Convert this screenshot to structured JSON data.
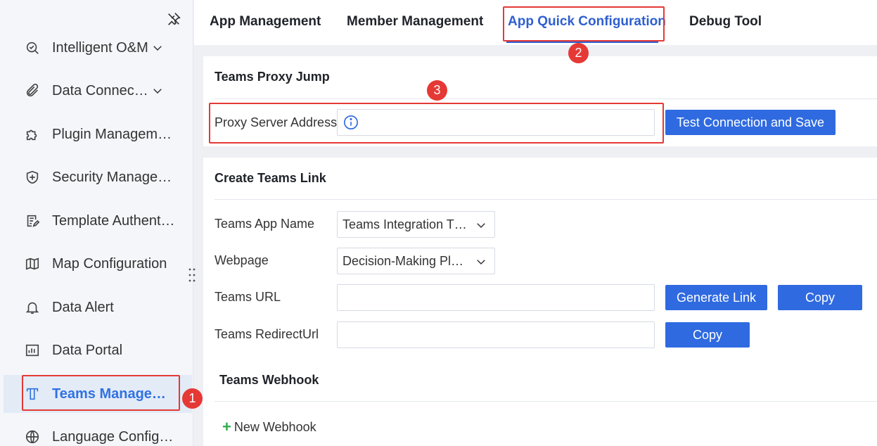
{
  "sidebar": {
    "items": [
      {
        "label": "Intelligent O&M",
        "icon": "om-icon",
        "has_chevron": true
      },
      {
        "label": "Data Connec…",
        "icon": "paperclip-icon",
        "has_chevron": true
      },
      {
        "label": "Plugin Managem…",
        "icon": "puzzle-icon"
      },
      {
        "label": "Security Manage…",
        "icon": "shield-icon"
      },
      {
        "label": "Template Authent…",
        "icon": "document-edit-icon"
      },
      {
        "label": "Map Configuration",
        "icon": "map-icon"
      },
      {
        "label": "Data Alert",
        "icon": "bell-icon"
      },
      {
        "label": "Data Portal",
        "icon": "portal-icon"
      },
      {
        "label": "Teams Manage…",
        "icon": "teams-t-icon",
        "active": true
      },
      {
        "label": "Language Config…",
        "icon": "globe-icon"
      }
    ]
  },
  "tabs": [
    {
      "label": "App Management"
    },
    {
      "label": "Member Management"
    },
    {
      "label": "App Quick Configuration",
      "active": true
    },
    {
      "label": "Debug Tool"
    }
  ],
  "proxy": {
    "title": "Teams Proxy Jump",
    "field_label": "Proxy Server Address",
    "field_value": "",
    "button_label": "Test Connection and Save"
  },
  "link": {
    "title": "Create Teams Link",
    "app_name_label": "Teams App Name",
    "app_name_value": "Teams Integration T…",
    "webpage_label": "Webpage",
    "webpage_value": "Decision-Making Pl…",
    "url_label": "Teams URL",
    "url_value": "",
    "generate_label": "Generate Link",
    "copy_label": "Copy",
    "redirect_label": "Teams RedirectUrl",
    "redirect_value": "",
    "copy2_label": "Copy"
  },
  "webhook": {
    "title": "Teams Webhook",
    "new_label": "New Webhook"
  },
  "annotations": [
    "1",
    "2",
    "3"
  ],
  "colors": {
    "accent": "#2f6ae0",
    "active_text": "#2f72e1",
    "highlight": "#e53935",
    "plus_green": "#2fae4f"
  }
}
